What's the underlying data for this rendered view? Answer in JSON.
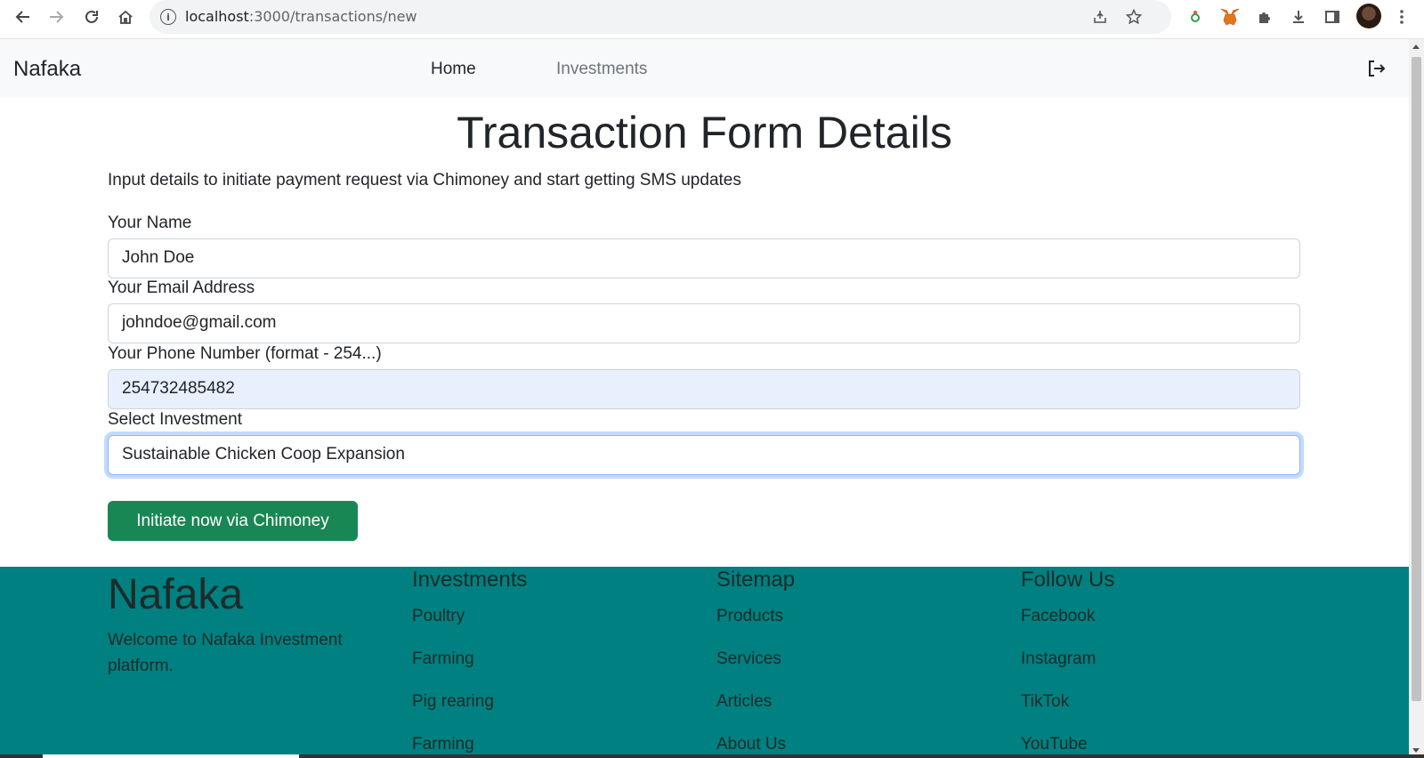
{
  "browser": {
    "url_host": "localhost",
    "url_path": ":3000/transactions/new",
    "icons": [
      "back-icon",
      "forward-icon",
      "reload-icon",
      "home-icon",
      "share-icon",
      "bookmark-star-icon",
      "extension-icon",
      "metamask-fox-icon",
      "puzzle-icon",
      "download-icon",
      "sidepanel-icon",
      "profile-avatar",
      "menu-icon"
    ]
  },
  "navbar": {
    "brand": "Nafaka",
    "links": [
      "Home",
      "Investments"
    ]
  },
  "main": {
    "title": "Transaction Form Details",
    "lead": "Input details to initiate payment request via Chimoney and start getting SMS updates",
    "fields": [
      {
        "label": "Your Name",
        "value": "John Doe"
      },
      {
        "label": "Your Email Address",
        "value": "johndoe@gmail.com"
      },
      {
        "label": "Your Phone Number (format - 254...)",
        "value": "254732485482"
      },
      {
        "label": "Select Investment",
        "value": "Sustainable Chicken Coop Expansion"
      }
    ],
    "submit_label": "Initiate now via Chimoney"
  },
  "footer": {
    "brand": "Nafaka",
    "welcome": "Welcome to Nafaka Investment platform.",
    "columns": [
      {
        "title": "Investments",
        "links": [
          "Poultry",
          "Farming",
          "Pig rearing",
          "Farming"
        ]
      },
      {
        "title": "Sitemap",
        "links": [
          "Products",
          "Services",
          "Articles",
          "About Us"
        ]
      },
      {
        "title": "Follow Us",
        "links": [
          "Facebook",
          "Instagram",
          "TikTok",
          "YouTube"
        ]
      }
    ]
  },
  "colors": {
    "footer_bg": "#008080",
    "button_bg": "#198754",
    "autofill_bg": "#e8f0fe"
  }
}
